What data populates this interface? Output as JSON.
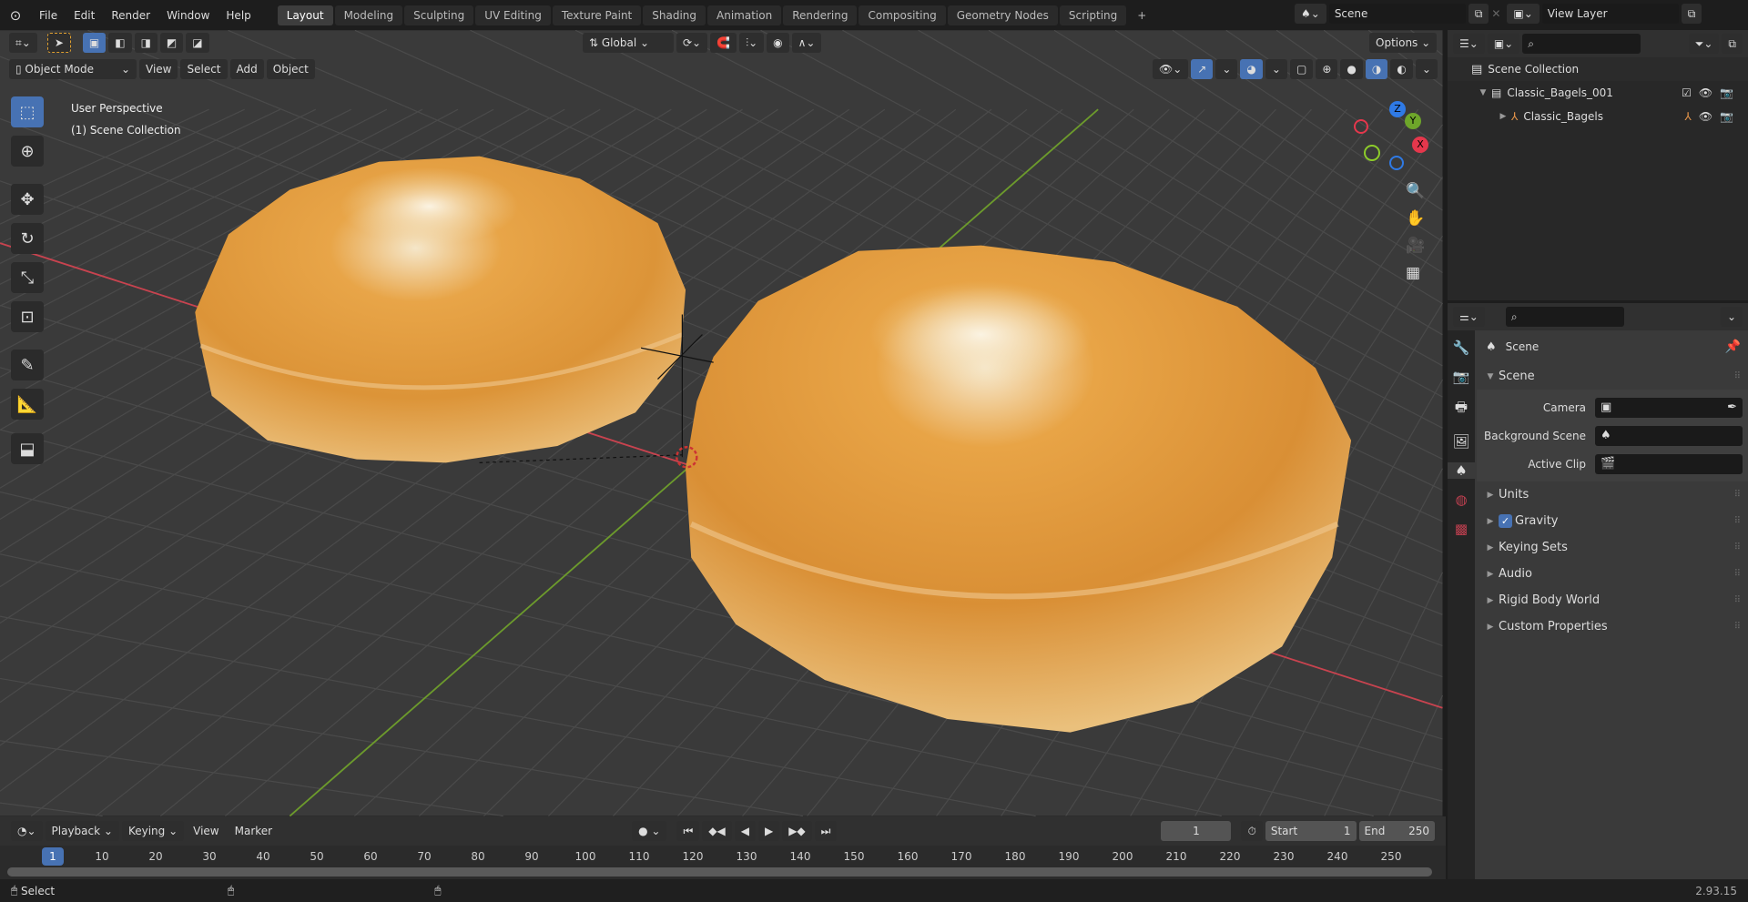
{
  "topbar": {
    "menus": [
      "File",
      "Edit",
      "Render",
      "Window",
      "Help"
    ],
    "workspaces": [
      "Layout",
      "Modeling",
      "Sculpting",
      "UV Editing",
      "Texture Paint",
      "Shading",
      "Animation",
      "Rendering",
      "Compositing",
      "Geometry Nodes",
      "Scripting"
    ],
    "active_workspace": "Layout",
    "add_tab": "+",
    "scene": "Scene",
    "view_layer": "View Layer"
  },
  "viewport": {
    "transform_orientation": "Global",
    "options": "Options",
    "mode": "Object Mode",
    "menus": [
      "View",
      "Select",
      "Add",
      "Object"
    ],
    "overlay_line1": "User Perspective",
    "overlay_line2": "(1) Scene Collection",
    "gizmo": {
      "z": "Z",
      "y": "Y",
      "x": "X"
    },
    "colors": {
      "x_axis": "#c8434f",
      "y_axis": "#6c9a2c",
      "bagel": "#e09a3a",
      "accent": "#4772b3"
    }
  },
  "outliner": {
    "root": "Scene Collection",
    "items": [
      {
        "label": "Classic_Bagels_001",
        "type": "collection"
      },
      {
        "label": "Classic_Bagels",
        "type": "object"
      }
    ]
  },
  "properties": {
    "title": "Scene",
    "section": "Scene",
    "fields": [
      {
        "label": "Camera",
        "value": ""
      },
      {
        "label": "Background Scene",
        "value": ""
      },
      {
        "label": "Active Clip",
        "value": ""
      }
    ],
    "panels": [
      "Units",
      "Gravity",
      "Keying Sets",
      "Audio",
      "Rigid Body World",
      "Custom Properties"
    ],
    "gravity_checked": true
  },
  "timeline": {
    "menus": [
      "Playback",
      "Keying",
      "View",
      "Marker"
    ],
    "current_frame": "1",
    "start_label": "Start",
    "start": "1",
    "end_label": "End",
    "end": "250",
    "ticks": [
      "10",
      "20",
      "30",
      "40",
      "50",
      "60",
      "70",
      "80",
      "90",
      "100",
      "110",
      "120",
      "130",
      "140",
      "150",
      "160",
      "170",
      "180",
      "190",
      "200",
      "210",
      "220",
      "230",
      "240",
      "250"
    ]
  },
  "statusbar": {
    "left": "Select",
    "version": "2.93.15"
  }
}
